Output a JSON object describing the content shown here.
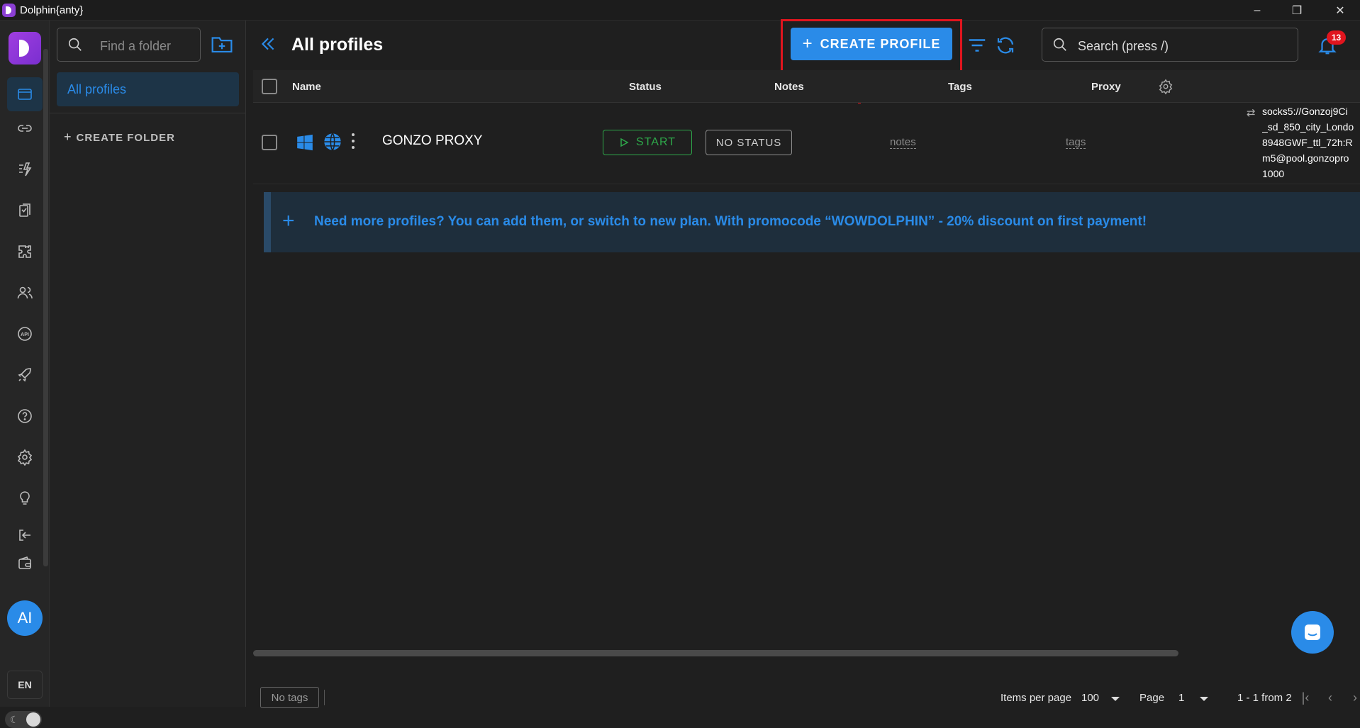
{
  "window": {
    "title": "Dolphin{anty}",
    "controls": [
      "–",
      "❐",
      "✕"
    ]
  },
  "rail": {
    "ai_label": "AI",
    "lang": "EN",
    "items": [
      "browser-profiles-icon",
      "link-icon",
      "automation-icon",
      "bookmarks-icon",
      "extensions-icon",
      "users-icon",
      "api-icon",
      "rocket-icon",
      "help-icon",
      "settings-icon",
      "lightbulb-icon",
      "logout-icon",
      "wallet-icon"
    ]
  },
  "folders": {
    "search_placeholder": "Find a folder",
    "all_profiles": "All profiles",
    "create_folder": "CREATE FOLDER",
    "plus": "+"
  },
  "header": {
    "title": "All profiles",
    "create_profile": "CREATE PROFILE",
    "plus": "+",
    "search_placeholder": "Search (press /)",
    "notifications_count": "13"
  },
  "table": {
    "columns": {
      "name": "Name",
      "status": "Status",
      "notes": "Notes",
      "tags": "Tags",
      "proxy": "Proxy"
    },
    "rows": [
      {
        "name": "GONZO PROXY",
        "start": "START",
        "status": "NO STATUS",
        "notes": "notes",
        "tags": "tags",
        "proxy_icon": "⇄",
        "proxy": "socks5://Gonzoj9Ci\n_sd_850_city_Londo\n8948GWF_ttl_72h:R\nm5@pool.gonzopro\n1000"
      }
    ]
  },
  "promo": {
    "plus": "+",
    "text": "Need more profiles? You can add them, or switch to new plan. With promocode “WOWDOLPHIN” - 20% discount on first payment!"
  },
  "footer": {
    "no_tags": "No tags",
    "items_per_page_label": "Items per page",
    "items_per_page": "100",
    "page_label": "Page",
    "page": "1",
    "range": "1 - 1 from 2",
    "first": "|‹",
    "prev": "‹",
    "next": "›",
    "last": "›|"
  },
  "colors": {
    "accent": "#2a8be8",
    "highlight": "#e0151e",
    "start_green": "#2ea84a"
  }
}
